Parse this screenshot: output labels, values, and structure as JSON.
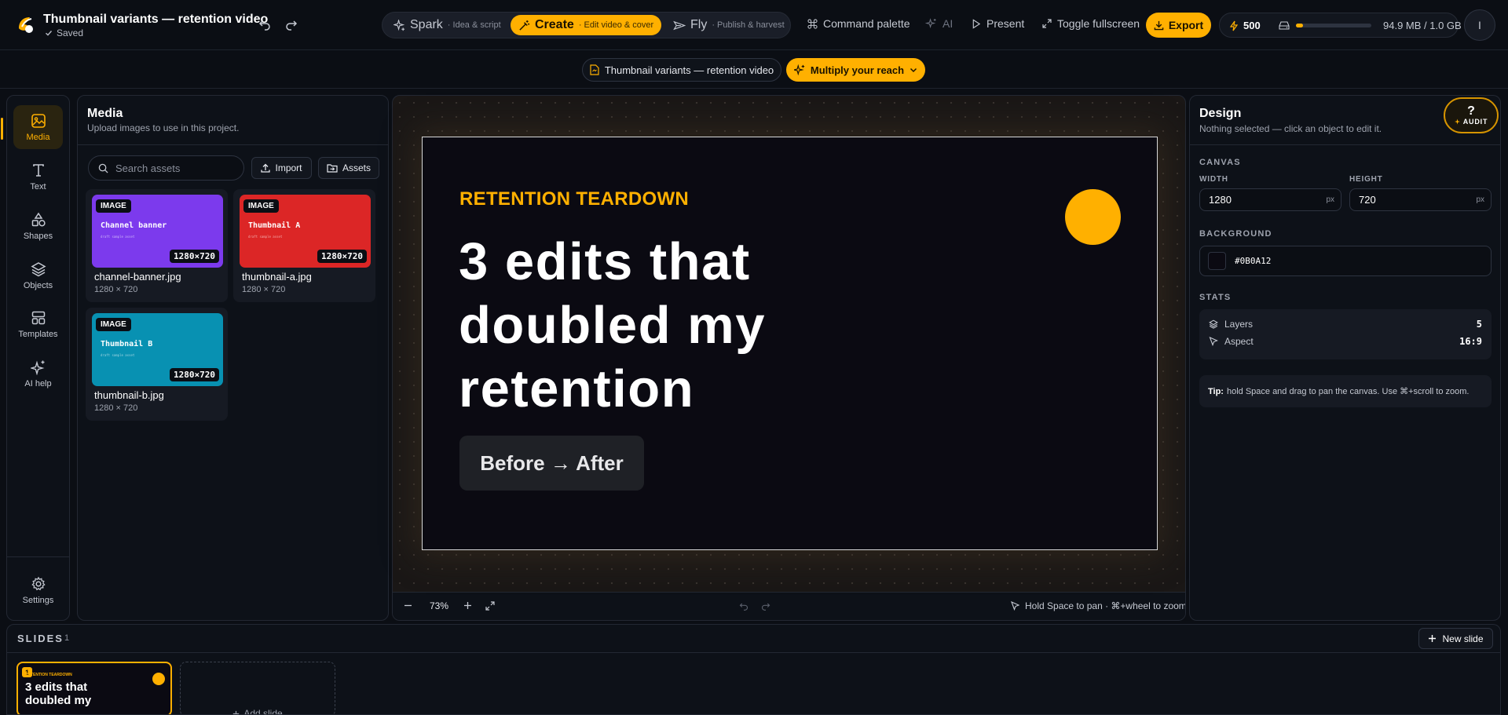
{
  "header": {
    "project_title": "Thumbnail variants — retention video",
    "save_status": "Saved",
    "modes": [
      {
        "name": "Spark",
        "subtitle": "· Idea & script"
      },
      {
        "name": "Create",
        "subtitle": "· Edit video & cover"
      },
      {
        "name": "Fly",
        "subtitle": "· Publish & harvest"
      }
    ],
    "active_mode": "Create",
    "command_palette": "Command palette",
    "ai": "AI",
    "present": "Present",
    "fullscreen": "Toggle fullscreen",
    "export": "Export",
    "credits": "500",
    "storage_text": "94.9 MB / 1.0 GB",
    "storage_used_fraction": 0.095,
    "avatar_initial": "I"
  },
  "subbar": {
    "breadcrumb": "Thumbnail variants — retention video",
    "reach_button": "Multiply your reach"
  },
  "rail": {
    "items": [
      {
        "label": "Media",
        "icon": "image-icon"
      },
      {
        "label": "Text",
        "icon": "text-icon"
      },
      {
        "label": "Shapes",
        "icon": "shapes-icon"
      },
      {
        "label": "Objects",
        "icon": "layers-icon"
      },
      {
        "label": "Templates",
        "icon": "templates-icon"
      },
      {
        "label": "AI help",
        "icon": "sparkles-icon"
      }
    ],
    "active": "Media",
    "settings": "Settings"
  },
  "media": {
    "title": "Media",
    "subtitle": "Upload images to use in this project.",
    "search_placeholder": "Search assets",
    "import_label": "Import",
    "assets_label": "Assets",
    "assets": [
      {
        "badge": "IMAGE",
        "thumb_title": "Channel banner",
        "thumb_sub": "draft sample asset",
        "dims": "1280×720",
        "filename": "channel-banner.jpg",
        "size": "1280 × 720",
        "color": "#7c3aed"
      },
      {
        "badge": "IMAGE",
        "thumb_title": "Thumbnail A",
        "thumb_sub": "draft sample asset",
        "dims": "1280×720",
        "filename": "thumbnail-a.jpg",
        "size": "1280 × 720",
        "color": "#dc2626"
      },
      {
        "badge": "IMAGE",
        "thumb_title": "Thumbnail B",
        "thumb_sub": "draft sample asset",
        "dims": "1280×720",
        "filename": "thumbnail-b.jpg",
        "size": "1280 × 720",
        "color": "#0891b2"
      }
    ]
  },
  "canvas": {
    "kicker": "RETENTION TEARDOWN",
    "headline": "3 edits that doubled my retention",
    "pill": "Before → After",
    "accent_color": "#ffb000"
  },
  "stage_footer": {
    "zoom": "73%",
    "hint": "Hold Space to pan · ⌘+wheel to zoom"
  },
  "design": {
    "title": "Design",
    "subtitle": "Nothing selected — click an object to edit it.",
    "canvas_section": "CANVAS",
    "width_label": "WIDTH",
    "width_value": "1280",
    "height_label": "HEIGHT",
    "height_value": "720",
    "unit": "px",
    "background_label": "BACKGROUND",
    "background_value": "#0B0A12",
    "stats_section": "STATS",
    "layers_label": "Layers",
    "layers_value": "5",
    "aspect_label": "Aspect",
    "aspect_value": "16:9",
    "tip_bold": "Tip:",
    "tip_text": "hold Space and drag to pan the canvas. Use ⌘+scroll to zoom.",
    "audit_q": "?",
    "audit_label": "AUDIT"
  },
  "slides": {
    "title": "SLIDES",
    "count": "1",
    "new_slide": "New slide",
    "add_slide": "Add slide",
    "slide1_number": "1",
    "slide1_kicker": "RETENTION TEARDOWN",
    "slide1_headline": "3 edits that doubled my"
  }
}
